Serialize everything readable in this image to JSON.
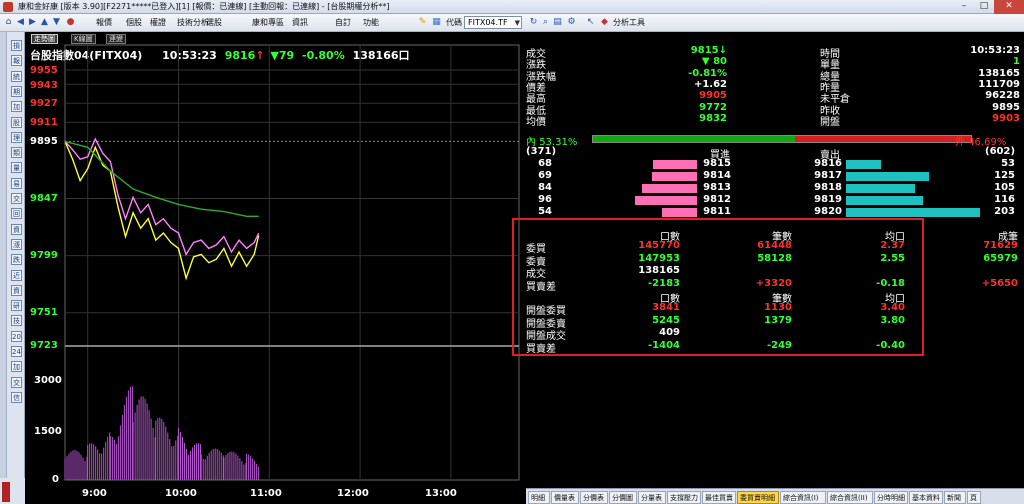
{
  "window": {
    "title": "康和金好康 [版本 3.90][F2271*****已登入][1] [報價：已連線] [主動回報：已連線] - [台股期權分析**]",
    "minimize": "–",
    "maximize": "□",
    "close": "✕"
  },
  "menu": {
    "items": [
      "報價",
      "個股",
      "權證",
      "技術分析",
      "選股",
      "康和專區",
      "資訊",
      "自訂",
      "功能"
    ],
    "symbol_label": "代碼",
    "symbol_value": "FITX04.TF",
    "analysis_tools": "分析工具"
  },
  "sidebar": {
    "buttons": [
      "損",
      "報",
      "統",
      "期",
      "加",
      "股",
      "理",
      "類",
      "量",
      "易",
      "交",
      "回",
      "資",
      "漲",
      "跌",
      "近",
      "資",
      "研",
      "技",
      "20",
      "24",
      "加",
      "交",
      "信"
    ]
  },
  "chart": {
    "tabs": [
      "走勢圖",
      "K線圖",
      "連變"
    ],
    "active_tab": "走勢圖",
    "title": "台股指數04(FITX04)",
    "time": "10:53:23",
    "price": "9816",
    "arrow": "↑",
    "change": "▼79",
    "change_pct": "-0.80%",
    "volume": "138166口",
    "price_ticks": [
      "9955",
      "9943",
      "9927",
      "9911",
      "9895",
      "9847",
      "9799",
      "9751",
      "9723"
    ],
    "volume_ticks": [
      "3000",
      "1500",
      "0"
    ],
    "time_ticks": [
      "9:00",
      "10:00",
      "11:00",
      "12:00",
      "13:00"
    ]
  },
  "chart_data": {
    "type": "line",
    "xlabel": "",
    "ylabel": "",
    "x_range": [
      "8:45",
      "13:45"
    ],
    "ylim": [
      9723,
      9955
    ],
    "reference_price": 9895,
    "series": [
      {
        "name": "",
        "color": "#ffff33",
        "x": [
          "8:45",
          "8:50",
          "8:55",
          "9:00",
          "9:05",
          "9:10",
          "9:15",
          "9:20",
          "9:25",
          "9:30",
          "9:35",
          "9:40",
          "9:45",
          "9:50",
          "9:55",
          "10:00",
          "10:05",
          "10:10",
          "10:15",
          "10:20",
          "10:25",
          "10:30",
          "10:35",
          "10:40",
          "10:45",
          "10:50",
          "10:53"
        ],
        "values": [
          9895,
          9880,
          9862,
          9872,
          9890,
          9875,
          9870,
          9840,
          9815,
          9835,
          9822,
          9830,
          9812,
          9818,
          9810,
          9805,
          9780,
          9798,
          9800,
          9793,
          9796,
          9805,
          9790,
          9802,
          9790,
          9800,
          9816
        ]
      },
      {
        "name": "",
        "color": "#ff80ff",
        "x": [
          "8:45",
          "8:50",
          "8:55",
          "9:00",
          "9:05",
          "9:10",
          "9:15",
          "9:20",
          "9:25",
          "9:30",
          "9:35",
          "9:40",
          "9:45",
          "9:50",
          "9:55",
          "10:00",
          "10:05",
          "10:10",
          "10:15",
          "10:20",
          "10:25",
          "10:30",
          "10:35",
          "10:40",
          "10:45",
          "10:50",
          "10:53"
        ],
        "values": [
          9895,
          9888,
          9880,
          9882,
          9897,
          9885,
          9878,
          9850,
          9830,
          9848,
          9835,
          9842,
          9825,
          9830,
          9822,
          9818,
          9800,
          9810,
          9812,
          9805,
          9808,
          9815,
          9802,
          9812,
          9805,
          9810,
          9818
        ]
      },
      {
        "name": "",
        "color": "#2eaa2e",
        "x": [
          "8:45",
          "9:00",
          "9:15",
          "9:30",
          "9:45",
          "10:00",
          "10:15",
          "10:30",
          "10:45",
          "10:53"
        ],
        "values": [
          9895,
          9890,
          9870,
          9855,
          9848,
          9842,
          9838,
          9836,
          9832,
          9832
        ]
      }
    ],
    "volume_series": {
      "color": "#b455d0",
      "x": [
        "8:45",
        "9:00",
        "9:15",
        "9:30",
        "9:45",
        "10:00",
        "10:15",
        "10:30",
        "10:45",
        "10:53"
      ],
      "values": [
        900,
        1200,
        1700,
        3400,
        2200,
        1800,
        1200,
        1000,
        900,
        700
      ]
    }
  },
  "quote": {
    "left": [
      {
        "label": "成交",
        "value": "9815↓",
        "cls": "green"
      },
      {
        "label": "漲跌",
        "value": "▼ 80",
        "cls": "green"
      },
      {
        "label": "漲跌幅",
        "value": "-0.81%",
        "cls": "green"
      },
      {
        "label": "價差",
        "value": "+1.62",
        "cls": "white"
      },
      {
        "label": "最高",
        "value": "9905",
        "cls": "red"
      },
      {
        "label": "最低",
        "value": "9772",
        "cls": "green"
      },
      {
        "label": "均價",
        "value": "9832",
        "cls": "green"
      }
    ],
    "right": [
      {
        "label": "時間",
        "value": "10:53:23",
        "cls": "white"
      },
      {
        "label": "單量",
        "value": "1",
        "cls": "green"
      },
      {
        "label": "總量",
        "value": "138165",
        "cls": "white"
      },
      {
        "label": "昨量",
        "value": "111709",
        "cls": "white"
      },
      {
        "label": "未平倉",
        "value": "96228",
        "cls": "white"
      },
      {
        "label": "昨收",
        "value": "9895",
        "cls": "white"
      },
      {
        "label": "開盤",
        "value": "9903",
        "cls": "red"
      }
    ]
  },
  "ratio": {
    "inner_label": "內",
    "inner_pct": "53.31%",
    "outer_label": "外",
    "outer_pct": "46.69%",
    "inner_fraction": 0.5331
  },
  "orderbook": {
    "bid_total": "(371)",
    "bid_header": "買進",
    "ask_header": "賣出",
    "ask_total": "(602)",
    "rows": [
      {
        "bid_qty": "68",
        "bid_price": "9815",
        "ask_price": "9816",
        "ask_qty": "53"
      },
      {
        "bid_qty": "69",
        "bid_price": "9814",
        "ask_price": "9817",
        "ask_qty": "125"
      },
      {
        "bid_qty": "84",
        "bid_price": "9813",
        "ask_price": "9818",
        "ask_qty": "105"
      },
      {
        "bid_qty": "96",
        "bid_price": "9812",
        "ask_price": "9819",
        "ask_qty": "116"
      },
      {
        "bid_qty": "54",
        "bid_price": "9811",
        "ask_price": "9820",
        "ask_qty": "203"
      }
    ]
  },
  "buysell": {
    "headers1": [
      "口數",
      "筆數",
      "均口",
      "成筆"
    ],
    "rows1": [
      {
        "label": "委買",
        "v1": "145770",
        "v2": "61448",
        "v3": "2.37",
        "v4": "71629",
        "c": "red"
      },
      {
        "label": "委賣",
        "v1": "147953",
        "v2": "58128",
        "v3": "2.55",
        "v4": "65979",
        "c": "green"
      },
      {
        "label": "成交",
        "v1": "138165",
        "v2": "",
        "v3": "",
        "v4": "",
        "c": "white"
      },
      {
        "label": "買賣差",
        "v1": "-2183",
        "v2": "+3320",
        "v3": "-0.18",
        "v4": "+5650",
        "c": "mixed"
      }
    ],
    "headers2": [
      "口數",
      "筆數",
      "均口"
    ],
    "rows2": [
      {
        "label": "開盤委買",
        "v1": "3841",
        "v2": "1130",
        "v3": "3.40",
        "c": "red"
      },
      {
        "label": "開盤委賣",
        "v1": "5245",
        "v2": "1379",
        "v3": "3.80",
        "c": "green"
      },
      {
        "label": "開盤成交",
        "v1": "409",
        "v2": "",
        "v3": "",
        "c": "white"
      },
      {
        "label": "買賣差",
        "v1": "-1404",
        "v2": "-249",
        "v3": "-0.40",
        "c": "green"
      }
    ]
  },
  "bottom_tabs": [
    "明細",
    "價量表",
    "分價表",
    "分價圖",
    "分量表",
    "支撐壓力",
    "最佳買賣",
    "委買賣明細",
    "綜合資訊(I)",
    "綜合資訊(II)",
    "分時明細",
    "基本資料",
    "新聞",
    "頁"
  ],
  "bottom_active": "委買賣明細"
}
